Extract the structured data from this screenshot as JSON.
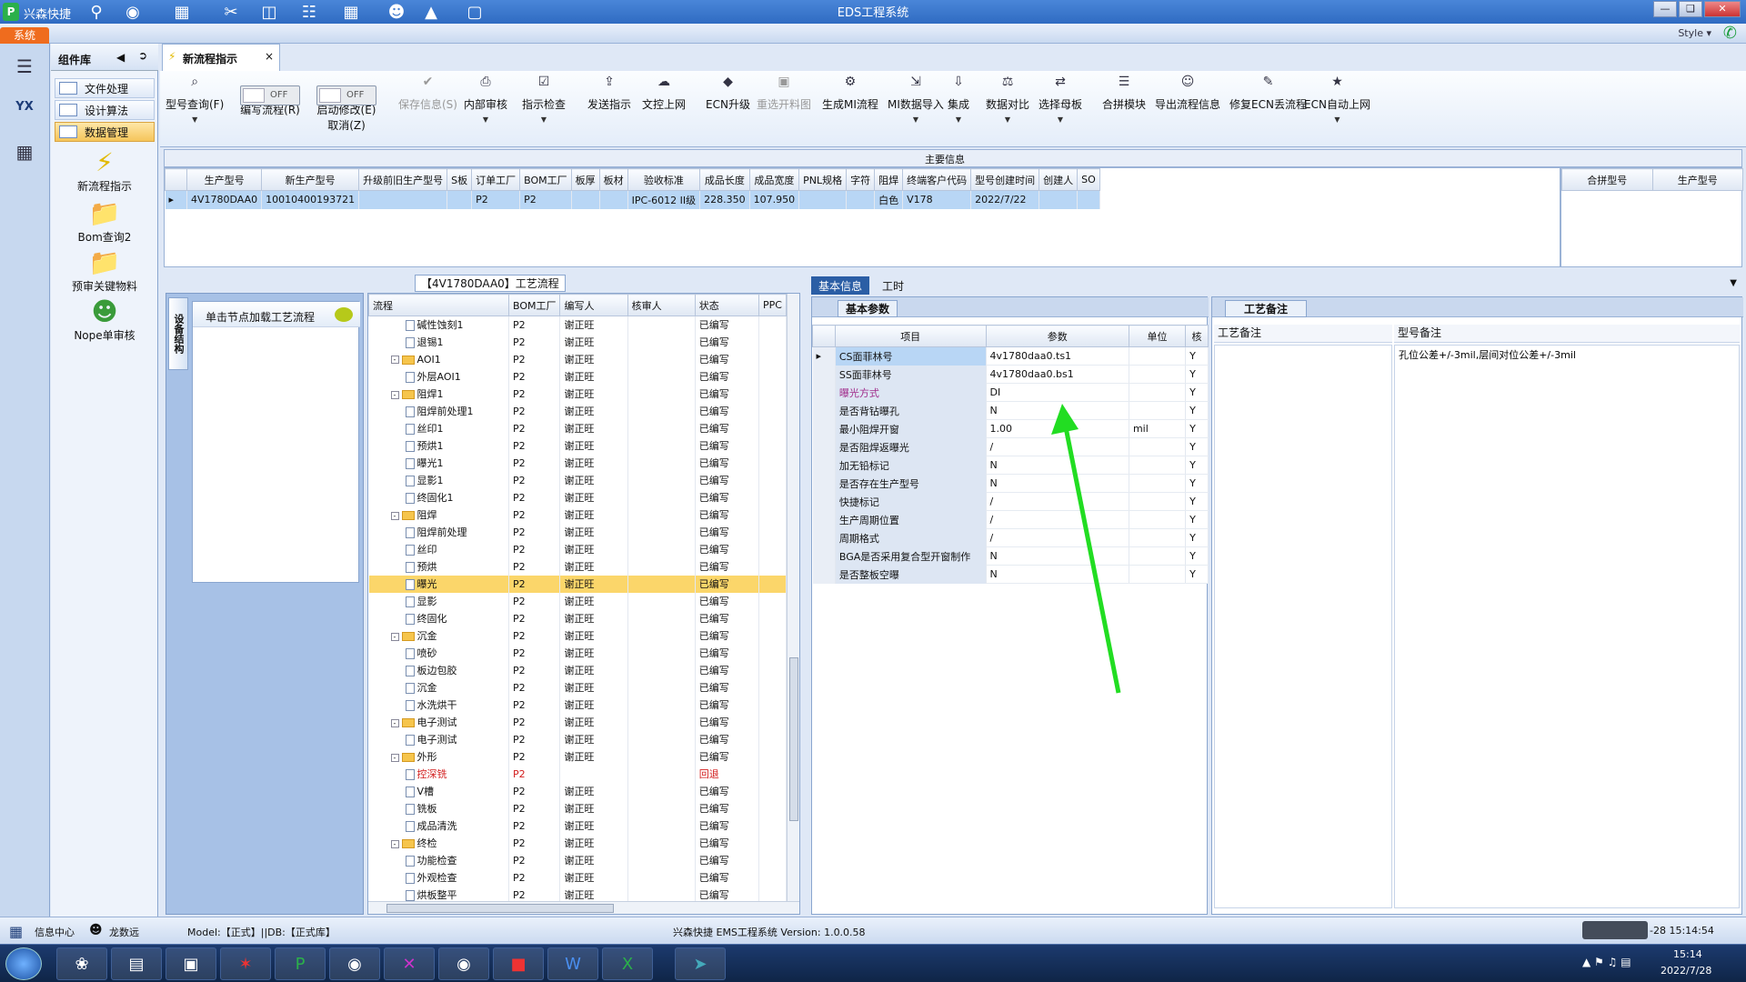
{
  "window": {
    "app_name": "兴森快捷",
    "title": "EDS工程系统"
  },
  "menubar": {
    "system_tab": "系统",
    "style_label": "Style"
  },
  "left_rail": {
    "avatar_label": "YX"
  },
  "component_lib": {
    "title": "组件库",
    "nav": [
      "文件处理",
      "设计算法",
      "数据管理"
    ],
    "tools": [
      "新流程指示",
      "Bom查询2",
      "预审关键物料",
      "Nope单审核"
    ]
  },
  "doc_tab": {
    "label": "新流程指示",
    "close": "×"
  },
  "ribbon": {
    "buttons": [
      {
        "label": "型号查询(F)",
        "icon": "search-icon",
        "arrow": true
      },
      {
        "label": "编写流程(R)",
        "toggle": "OFF"
      },
      {
        "label": "启动修改(E)",
        "toggle": "OFF",
        "sub": "取消(Z)"
      },
      {
        "label": "保存信息(S)",
        "icon": "check-icon",
        "disabled": true
      },
      {
        "label": "内部审核",
        "icon": "print-icon",
        "arrow": true
      },
      {
        "label": "指示检查",
        "icon": "check-doc-icon",
        "arrow": true
      },
      {
        "label": "发送指示",
        "icon": "upload-icon"
      },
      {
        "label": "文控上网",
        "icon": "cloud-upload-icon"
      },
      {
        "label": "ECN升级",
        "icon": "ecn-icon"
      },
      {
        "label": "重选开料图",
        "icon": "image-icon",
        "disabled": true
      },
      {
        "label": "生成MI流程",
        "icon": "gears-icon"
      },
      {
        "label": "MI数据导入",
        "icon": "import-icon",
        "arrow": true
      },
      {
        "label": "集成",
        "icon": "integrate-icon",
        "arrow": true
      },
      {
        "label": "数据对比",
        "icon": "compare-icon",
        "arrow": true
      },
      {
        "label": "选择母板",
        "icon": "shuffle-icon",
        "arrow": true
      },
      {
        "label": "合拼模块",
        "icon": "list-icon"
      },
      {
        "label": "导出流程信息",
        "icon": "export-icon"
      },
      {
        "label": "修复ECN丢流程",
        "icon": "wrench-icon"
      },
      {
        "label": "ECN自动上网",
        "icon": "star-icon",
        "arrow": true
      }
    ]
  },
  "main_info": {
    "title": "主要信息",
    "columns": [
      "生产型号",
      "新生产型号",
      "升级前旧生产型号",
      "S板",
      "订单工厂",
      "BOM工厂",
      "板厚",
      "板材",
      "验收标准",
      "成品长度",
      "成品宽度",
      "PNL规格",
      "字符",
      "阻焊",
      "终端客户代码",
      "型号创建时间",
      "创建人",
      "SO"
    ],
    "row": [
      "4V1780DAA0",
      "10010400193721",
      "",
      "",
      "P2",
      "P2",
      "",
      "",
      "IPC-6012 II级",
      "228.350",
      "107.950",
      "",
      "",
      "白色",
      "V178",
      "2022/7/22",
      "",
      ""
    ],
    "right_columns": [
      "合拼型号",
      "生产型号"
    ]
  },
  "flow": {
    "title": "【4V1780DAA0】工艺流程",
    "side_tab": "设备结构",
    "click_hint": "单击节点加载工艺流程",
    "columns": [
      "流程",
      "BOM工厂",
      "编写人",
      "核审人",
      "状态",
      "PPC"
    ],
    "rows": [
      {
        "name": "碱性蚀刻1",
        "lvl": 2,
        "f": "P2",
        "w": "谢正旺",
        "s": "已编写"
      },
      {
        "name": "退锡1",
        "lvl": 2,
        "f": "P2",
        "w": "谢正旺",
        "s": "已编写"
      },
      {
        "name": "AOI1",
        "lvl": 1,
        "folder": true,
        "f": "P2",
        "w": "谢正旺",
        "s": "已编写"
      },
      {
        "name": "外层AOI1",
        "lvl": 2,
        "f": "P2",
        "w": "谢正旺",
        "s": "已编写"
      },
      {
        "name": "阻焊1",
        "lvl": 1,
        "folder": true,
        "f": "P2",
        "w": "谢正旺",
        "s": "已编写"
      },
      {
        "name": "阻焊前处理1",
        "lvl": 2,
        "f": "P2",
        "w": "谢正旺",
        "s": "已编写"
      },
      {
        "name": "丝印1",
        "lvl": 2,
        "f": "P2",
        "w": "谢正旺",
        "s": "已编写"
      },
      {
        "name": "预烘1",
        "lvl": 2,
        "f": "P2",
        "w": "谢正旺",
        "s": "已编写"
      },
      {
        "name": "曝光1",
        "lvl": 2,
        "f": "P2",
        "w": "谢正旺",
        "s": "已编写"
      },
      {
        "name": "显影1",
        "lvl": 2,
        "f": "P2",
        "w": "谢正旺",
        "s": "已编写"
      },
      {
        "name": "终固化1",
        "lvl": 2,
        "f": "P2",
        "w": "谢正旺",
        "s": "已编写"
      },
      {
        "name": "阻焊",
        "lvl": 1,
        "folder": true,
        "f": "P2",
        "w": "谢正旺",
        "s": "已编写"
      },
      {
        "name": "阻焊前处理",
        "lvl": 2,
        "f": "P2",
        "w": "谢正旺",
        "s": "已编写"
      },
      {
        "name": "丝印",
        "lvl": 2,
        "f": "P2",
        "w": "谢正旺",
        "s": "已编写"
      },
      {
        "name": "预烘",
        "lvl": 2,
        "f": "P2",
        "w": "谢正旺",
        "s": "已编写"
      },
      {
        "name": "曝光",
        "lvl": 2,
        "f": "P2",
        "w": "谢正旺",
        "s": "已编写",
        "hl": true
      },
      {
        "name": "显影",
        "lvl": 2,
        "f": "P2",
        "w": "谢正旺",
        "s": "已编写"
      },
      {
        "name": "终固化",
        "lvl": 2,
        "f": "P2",
        "w": "谢正旺",
        "s": "已编写"
      },
      {
        "name": "沉金",
        "lvl": 1,
        "folder": true,
        "f": "P2",
        "w": "谢正旺",
        "s": "已编写"
      },
      {
        "name": "喷砂",
        "lvl": 2,
        "f": "P2",
        "w": "谢正旺",
        "s": "已编写"
      },
      {
        "name": "板边包胶",
        "lvl": 2,
        "f": "P2",
        "w": "谢正旺",
        "s": "已编写"
      },
      {
        "name": "沉金",
        "lvl": 2,
        "f": "P2",
        "w": "谢正旺",
        "s": "已编写"
      },
      {
        "name": "水洗烘干",
        "lvl": 2,
        "f": "P2",
        "w": "谢正旺",
        "s": "已编写"
      },
      {
        "name": "电子测试",
        "lvl": 1,
        "folder": true,
        "f": "P2",
        "w": "谢正旺",
        "s": "已编写"
      },
      {
        "name": "电子测试",
        "lvl": 2,
        "f": "P2",
        "w": "谢正旺",
        "s": "已编写"
      },
      {
        "name": "外形",
        "lvl": 1,
        "folder": true,
        "f": "P2",
        "w": "谢正旺",
        "s": "已编写"
      },
      {
        "name": "控深铣",
        "lvl": 2,
        "f": "P2",
        "w": "",
        "s": "回退",
        "red": true
      },
      {
        "name": "V槽",
        "lvl": 2,
        "f": "P2",
        "w": "谢正旺",
        "s": "已编写"
      },
      {
        "name": "铣板",
        "lvl": 2,
        "f": "P2",
        "w": "谢正旺",
        "s": "已编写"
      },
      {
        "name": "成品清洗",
        "lvl": 2,
        "f": "P2",
        "w": "谢正旺",
        "s": "已编写"
      },
      {
        "name": "终检",
        "lvl": 1,
        "folder": true,
        "f": "P2",
        "w": "谢正旺",
        "s": "已编写"
      },
      {
        "name": "功能检查",
        "lvl": 2,
        "f": "P2",
        "w": "谢正旺",
        "s": "已编写"
      },
      {
        "name": "外观检查",
        "lvl": 2,
        "f": "P2",
        "w": "谢正旺",
        "s": "已编写"
      },
      {
        "name": "烘板整平",
        "lvl": 2,
        "f": "P2",
        "w": "谢正旺",
        "s": "已编写"
      }
    ]
  },
  "info": {
    "tabs": [
      "基本信息",
      "工时"
    ],
    "section": "基本参数",
    "columns": [
      "项目",
      "参数",
      "单位",
      "核"
    ],
    "rows": [
      {
        "k": "CS面菲林号",
        "v": "4v1780daa0.ts1",
        "u": "",
        "c": "Y"
      },
      {
        "k": "SS面菲林号",
        "v": "4v1780daa0.bs1",
        "u": "",
        "c": "Y"
      },
      {
        "k": "曝光方式",
        "v": "DI",
        "u": "",
        "c": "Y",
        "pink": true
      },
      {
        "k": "是否背钻曝孔",
        "v": "N",
        "u": "",
        "c": "Y"
      },
      {
        "k": "最小阻焊开窗",
        "v": "1.00",
        "u": "mil",
        "c": "Y"
      },
      {
        "k": "是否阻焊返曝光",
        "v": "/",
        "u": "",
        "c": "Y"
      },
      {
        "k": "加无铅标记",
        "v": "N",
        "u": "",
        "c": "Y"
      },
      {
        "k": "是否存在生产型号",
        "v": "N",
        "u": "",
        "c": "Y"
      },
      {
        "k": "快捷标记",
        "v": "/",
        "u": "",
        "c": "Y"
      },
      {
        "k": "生产周期位置",
        "v": "/",
        "u": "",
        "c": "Y"
      },
      {
        "k": "周期格式",
        "v": "/",
        "u": "",
        "c": "Y"
      },
      {
        "k": "BGA是否采用复合型开窗制作",
        "v": "N",
        "u": "",
        "c": "Y"
      },
      {
        "k": "是否整板空曝",
        "v": "N",
        "u": "",
        "c": "Y"
      }
    ]
  },
  "process_notes": {
    "section": "工艺备注",
    "col1": "工艺备注",
    "col2": "型号备注",
    "model_note": "孔位公差+/-3mil,层间对位公差+/-3mil"
  },
  "status": {
    "info_center": "信息中心",
    "user": "龙数远",
    "model": "Model:【正式】||DB:【正式库】",
    "version": "兴森快捷  EMS工程系统  Version: 1.0.0.58",
    "clock_short": "-28 15:14:54",
    "time": "15:14",
    "date": "2022/7/28"
  },
  "colors": {
    "accent": "#2b5ea5",
    "highlight": "#fbd66a",
    "arrow": "#22dd22"
  }
}
